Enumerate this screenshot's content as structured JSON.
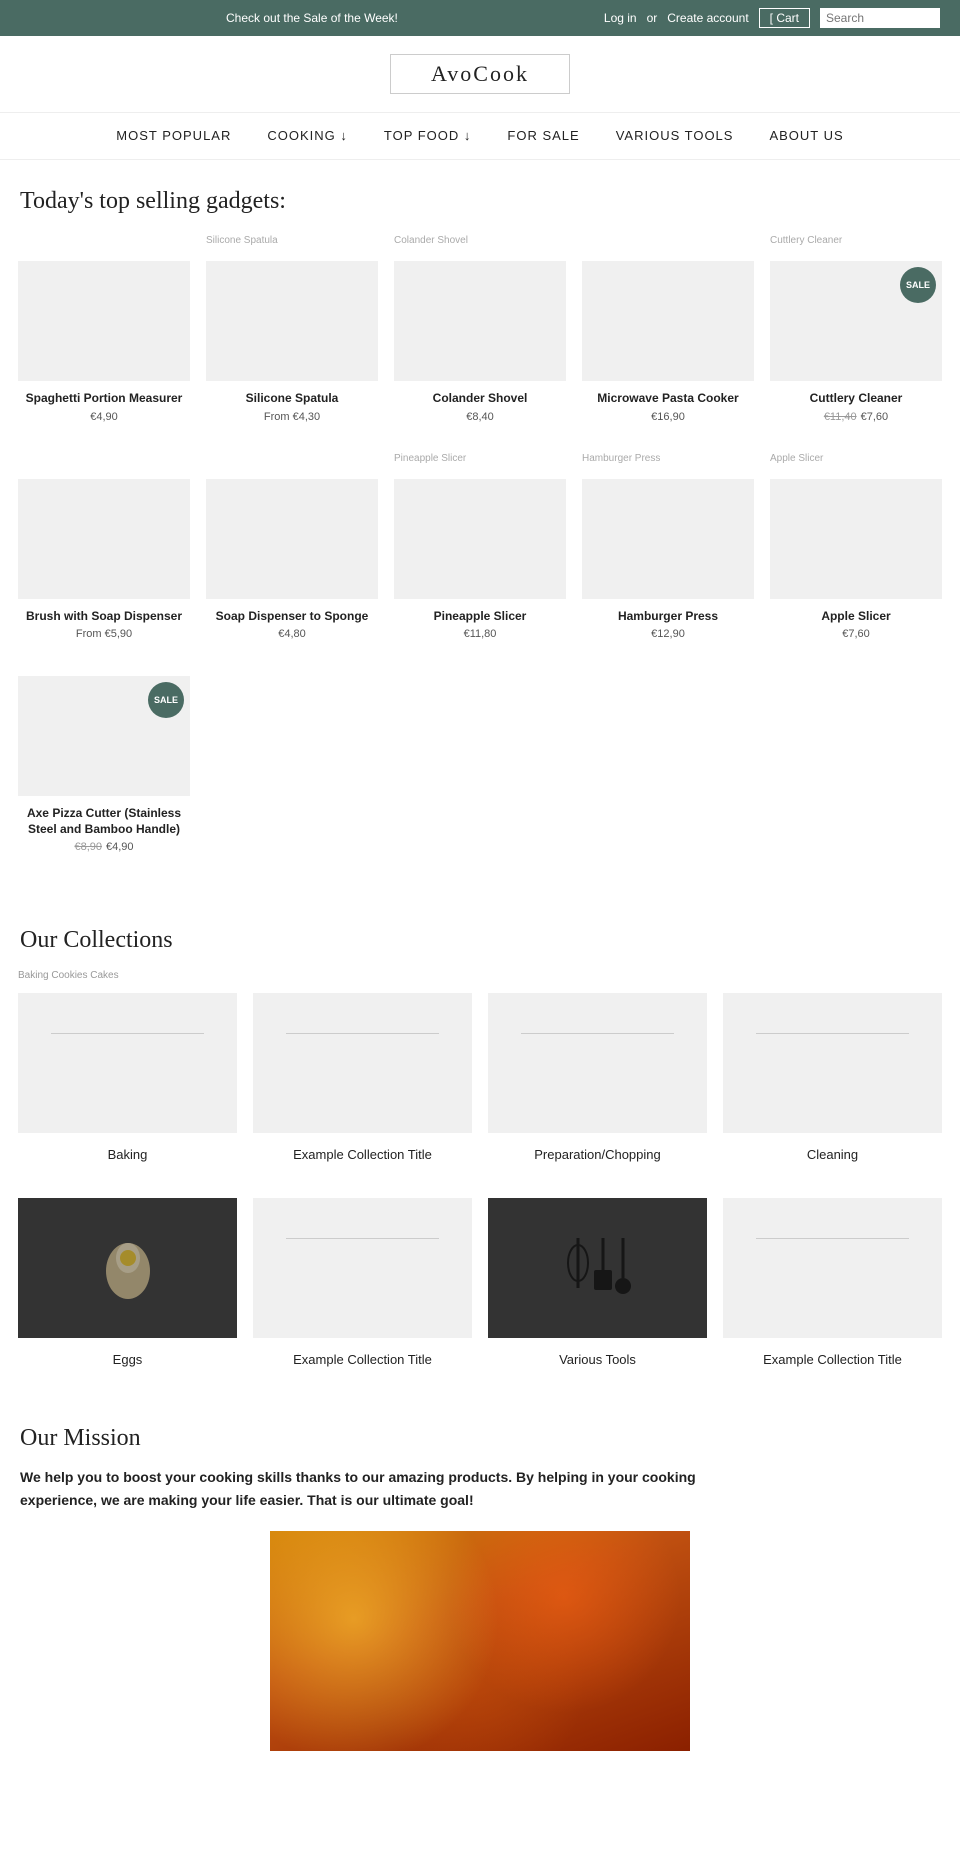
{
  "topbar": {
    "promo": "Check out the Sale of the Week!",
    "login": "Log in",
    "or": "or",
    "create": "Create account",
    "cart": "[ Cart",
    "search_placeholder": "Search"
  },
  "header": {
    "logo": "AvoCook"
  },
  "nav": {
    "items": [
      {
        "label": "MOST POPULAR"
      },
      {
        "label": "COOKING ↓"
      },
      {
        "label": "TOP FOOD ↓"
      },
      {
        "label": "FOR SALE"
      },
      {
        "label": "VARIOUS TOOLS"
      },
      {
        "label": "ABOUT US"
      }
    ]
  },
  "top_section": {
    "title": "Today's top selling gadgets:"
  },
  "products_row1": [
    {
      "name": "Spaghetti Portion Measurer",
      "price": "€4,90",
      "original": "",
      "sale": false,
      "img_label": ""
    },
    {
      "name": "Silicone Spatula",
      "price": "From €4,30",
      "original": "",
      "sale": false,
      "img_label": "Silicone Spatula"
    },
    {
      "name": "Colander Shovel",
      "price": "€8,40",
      "original": "",
      "sale": false,
      "img_label": "Colander Shovel"
    },
    {
      "name": "Microwave Pasta Cooker",
      "price": "€16,90",
      "original": "",
      "sale": false,
      "img_label": ""
    },
    {
      "name": "Cuttlery Cleaner",
      "price": "€7,60",
      "original": "€11,40",
      "sale": true,
      "img_label": "Cuttlery Cleaner"
    }
  ],
  "products_row2": [
    {
      "name": "Brush with Soap Dispenser",
      "price": "From €5,90",
      "original": "",
      "sale": false,
      "img_label": ""
    },
    {
      "name": "Soap Dispenser to Sponge",
      "price": "€4,80",
      "original": "",
      "sale": false,
      "img_label": ""
    },
    {
      "name": "Pineapple Slicer",
      "price": "€11,80",
      "original": "",
      "sale": false,
      "img_label": "Pineapple Slicer"
    },
    {
      "name": "Hamburger Press",
      "price": "€12,90",
      "original": "",
      "sale": false,
      "img_label": "Hamburger Press"
    },
    {
      "name": "Apple Slicer",
      "price": "€7,60",
      "original": "",
      "sale": false,
      "img_label": "Apple Slicer"
    }
  ],
  "products_row3": [
    {
      "name": "Axe Pizza Cutter (Stainless Steel and Bamboo Handle)",
      "price": "€4,90",
      "original": "€8,90",
      "sale": true,
      "img_label": ""
    }
  ],
  "collections_section": {
    "title": "Our Collections",
    "baking_label": "Baking Cookies Cakes"
  },
  "collections_row1": [
    {
      "name": "Baking",
      "has_image": false
    },
    {
      "name": "Example Collection Title",
      "has_image": false
    },
    {
      "name": "Preparation/Chopping",
      "has_image": false
    },
    {
      "name": "Cleaning",
      "has_image": false
    }
  ],
  "collections_row2": [
    {
      "name": "Eggs",
      "has_image": true,
      "type": "eggs"
    },
    {
      "name": "Example Collection Title",
      "has_image": false
    },
    {
      "name": "Various Tools",
      "has_image": true,
      "type": "tools"
    },
    {
      "name": "Example Collection Title",
      "has_image": false
    }
  ],
  "mission": {
    "title": "Our Mission",
    "text": "We help you to boost your cooking skills thanks to our amazing products. By helping in your cooking experience, we are making your life easier. That is our ultimate goal!"
  }
}
